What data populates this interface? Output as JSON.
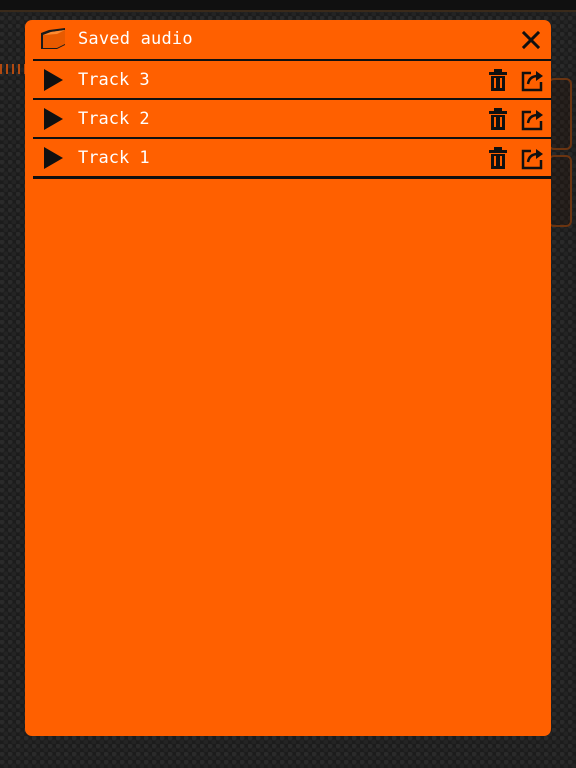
{
  "dialog": {
    "title": "Saved audio",
    "icon": "folder-icon",
    "close_icon": "close-icon"
  },
  "tracks": [
    {
      "label": "Track 3",
      "play_icon": "play-icon",
      "delete_icon": "trash-icon",
      "share_icon": "share-icon"
    },
    {
      "label": "Track 2",
      "play_icon": "play-icon",
      "delete_icon": "trash-icon",
      "share_icon": "share-icon"
    },
    {
      "label": "Track 1",
      "play_icon": "play-icon",
      "delete_icon": "trash-icon",
      "share_icon": "share-icon"
    }
  ],
  "colors": {
    "panel": "#ff6000",
    "text": "#ffffff",
    "icons": "#101010",
    "background": "#1c1c1c"
  }
}
